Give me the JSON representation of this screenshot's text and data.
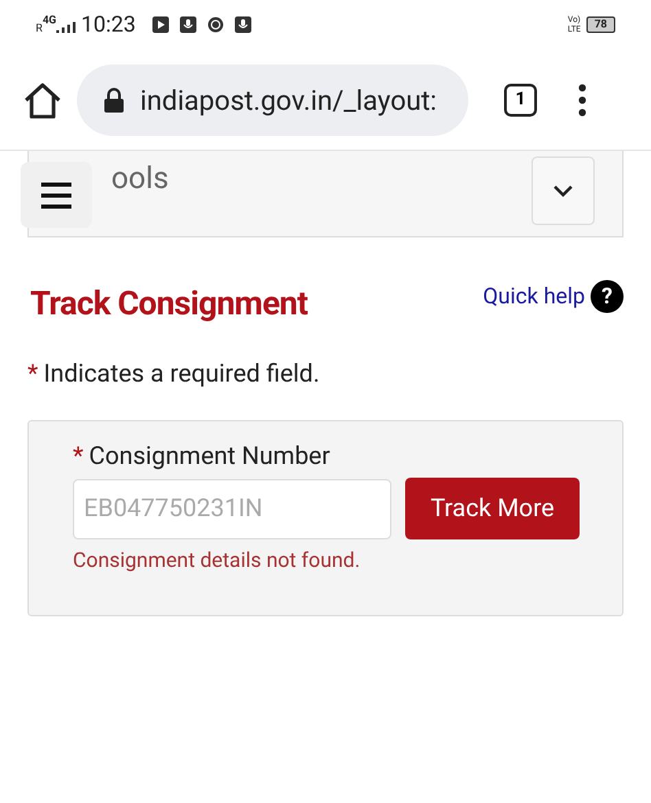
{
  "status_bar": {
    "network": "4G",
    "roaming": "R",
    "time": "10:23",
    "volte_top": "Vo)",
    "volte_bottom": "LTE",
    "battery": "78"
  },
  "browser": {
    "url": "indiapost.gov.in/_layout:",
    "tab_count": "1"
  },
  "tools_bar": {
    "label": "ools"
  },
  "page": {
    "title": "Track Consignment",
    "help_link": "Quick help",
    "help_icon": "?",
    "required_mark": "*",
    "required_note": "Indicates a required field."
  },
  "form": {
    "label": "Consignment Number",
    "required_mark": "*",
    "placeholder": "EB047750231IN",
    "button": "Track More",
    "error": "Consignment details not found."
  }
}
